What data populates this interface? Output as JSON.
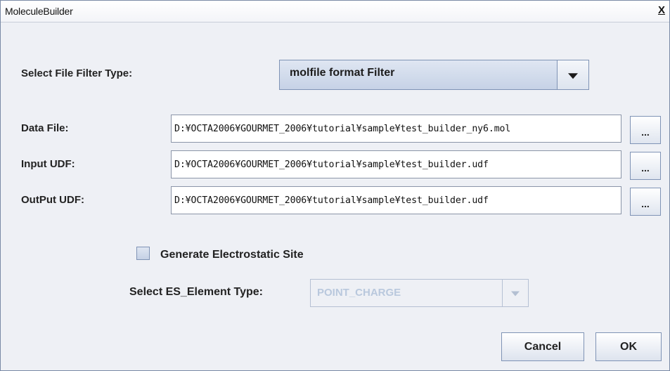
{
  "window": {
    "title": "MoleculeBuilder",
    "close_glyph": "X"
  },
  "filter": {
    "label": "Select File Filter Type:",
    "selected": "molfile format Filter"
  },
  "files": {
    "data_file": {
      "label": "Data File:",
      "value": "D:¥OCTA2006¥GOURMET_2006¥tutorial¥sample¥test_builder_ny6.mol"
    },
    "input_udf": {
      "label": "Input UDF:",
      "value": "D:¥OCTA2006¥GOURMET_2006¥tutorial¥sample¥test_builder.udf"
    },
    "output_udf": {
      "label": "OutPut UDF:",
      "value": "D:¥OCTA2006¥GOURMET_2006¥tutorial¥sample¥test_builder.udf"
    },
    "browse_label": "..."
  },
  "electrostatic": {
    "checkbox_label": "Generate Electrostatic Site",
    "checked": false,
    "element_type_label": "Select ES_Element Type:",
    "element_type_selected": "POINT_CHARGE"
  },
  "buttons": {
    "cancel": "Cancel",
    "ok": "OK"
  }
}
